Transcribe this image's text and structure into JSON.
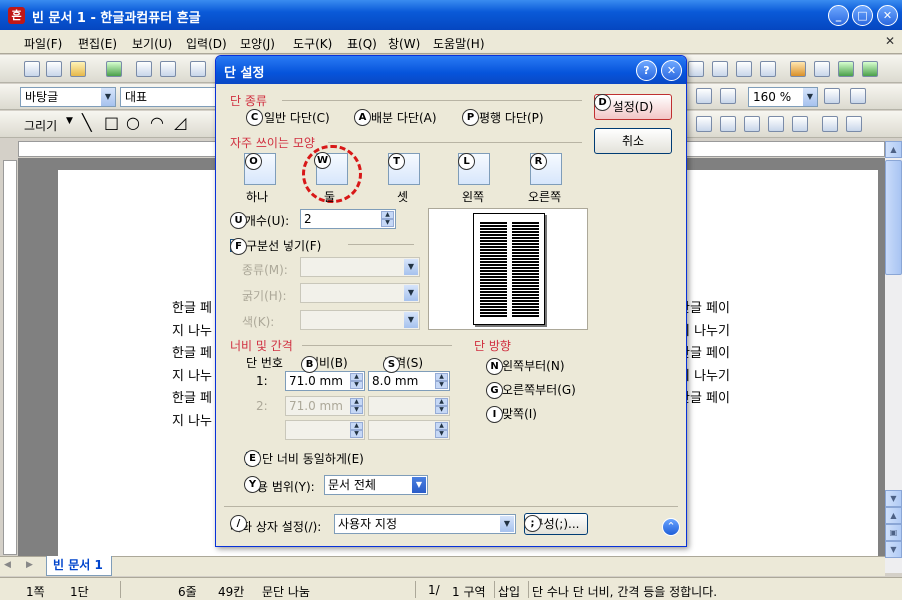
{
  "window": {
    "title": "빈 문서 1 - 한글과컴퓨터 흔글",
    "app_icon": "흔"
  },
  "menu": [
    "파일(F)",
    "편집(E)",
    "보기(U)",
    "입력(D)",
    "모양(J)",
    "도구(K)",
    "표(Q)",
    "창(W)",
    "도움말(H)"
  ],
  "format_bar": {
    "style": "바탕글",
    "font": "대표",
    "zoom": "160 %"
  },
  "drawing_bar": {
    "label": "그리기"
  },
  "document": {
    "lines_left": [
      "한글 페",
      "지 나누",
      "한글 페",
      "지 나누",
      "한글 페",
      "지 나누"
    ],
    "lines_right": [
      "한글 페이",
      "기 나누기",
      "한글 페이",
      "기 나누기",
      "한글 페이",
      ""
    ]
  },
  "tab": {
    "label": "빈 문서 1"
  },
  "status": {
    "page": "1쪽",
    "section": "1단",
    "line": "6줄",
    "column": "49칸",
    "mode": "문단 나눔",
    "pages": "1/",
    "area": "1 구역",
    "insert": "삽입",
    "message": "단 수나 단 너비, 간격 등을 정합니다."
  },
  "dialog": {
    "title": "단 설정",
    "ok_label": "설정(D)",
    "cancel_label": "취소",
    "type_group": "단 종류",
    "type_options": [
      "일반 다단(C)",
      "배분 다단(A)",
      "평행 다단(P)"
    ],
    "preset_group": "자주 쓰이는 모양",
    "presets": [
      "하나",
      "둘",
      "셋",
      "왼쪽",
      "오른쪽"
    ],
    "count_label": "단 개수(U):",
    "count_value": "2",
    "divider_label": "구분선 넣기(F)",
    "divider_type_label": "종류(M):",
    "divider_width_label": "굵기(H):",
    "divider_color_label": "색(K):",
    "width_group": "너비 및 간격",
    "col_number_label": "단 번호",
    "width_label": "너비(B)",
    "gap_label": "간격(S)",
    "row1_label": "1:",
    "row1_width": "71.0 mm",
    "row1_gap": "8.0 mm",
    "row2_label": "2:",
    "row2_width": "71.0 mm",
    "direction_group": "단 방향",
    "direction_options": [
      "왼쪽부터(N)",
      "오른쪽부터(G)",
      "맞쪽(I)"
    ],
    "equal_width_label": "단 너비 동일하게(E)",
    "apply_label": "적용 범위(Y):",
    "apply_value": "문서 전체",
    "user_setting_label": "대화 상자 설정(/):",
    "user_setting_value": "사용자 지정",
    "user_setting_button": "구성(;)...",
    "hints": [
      "D",
      "C",
      "A",
      "P",
      "O",
      "W",
      "T",
      "L",
      "R",
      "U",
      "F",
      "B",
      "S",
      "N",
      "G",
      "I",
      "E",
      "Y",
      "/",
      ";"
    ]
  }
}
